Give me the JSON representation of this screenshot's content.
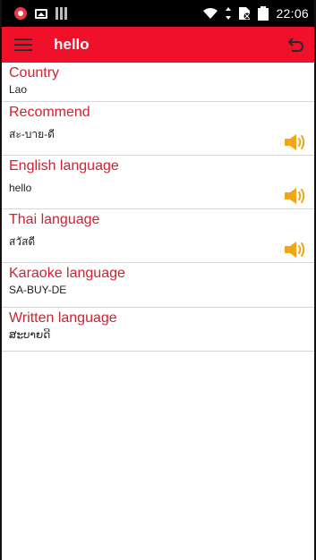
{
  "status_bar": {
    "time": "22:06"
  },
  "toolbar": {
    "title": "hello"
  },
  "rows": [
    {
      "label": "Country",
      "value": "Lao",
      "speaker": false
    },
    {
      "label": "Recommend",
      "value": "สะ-บาย-ดี",
      "speaker": true
    },
    {
      "label": "English language",
      "value": "hello",
      "speaker": true
    },
    {
      "label": "Thai language",
      "value": "สวัสดี",
      "speaker": true
    },
    {
      "label": "Karaoke language",
      "value": "SA-BUY-DE",
      "speaker": false
    },
    {
      "label": "Written language",
      "value": "ສະບາຍດີ",
      "speaker": false
    }
  ],
  "icons": {
    "menu": "menu-icon",
    "back": "back-arrow-icon",
    "speaker": "speaker-icon"
  },
  "colors": {
    "toolbar": "#f0102a",
    "label": "#d3222f",
    "speaker": "#f2a516"
  }
}
